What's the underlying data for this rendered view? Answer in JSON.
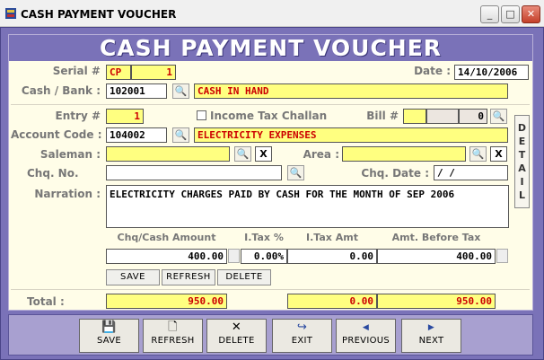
{
  "window": {
    "title": "CASH PAYMENT VOUCHER",
    "minimize_glyph": "_",
    "maximize_glyph": "□",
    "close_glyph": "✕"
  },
  "banner": "CASH PAYMENT VOUCHER",
  "serial": {
    "label": "Serial #",
    "prefix": "CP",
    "number": "1"
  },
  "date": {
    "label": "Date :",
    "value": "14/10/2006"
  },
  "cash_bank": {
    "label": "Cash / Bank :",
    "code": "102001",
    "name": "CASH IN HAND"
  },
  "entry": {
    "label": "Entry #",
    "value": "1"
  },
  "income_tax_challan": {
    "label": "Income Tax Challan",
    "checked": false
  },
  "bill": {
    "label": "Bill #",
    "value": "0"
  },
  "account_code": {
    "label": "Account Code :",
    "code": "104002",
    "name": "ELECTRICITY EXPENSES"
  },
  "saleman": {
    "label": "Saleman :",
    "value": "",
    "clear_glyph": "X"
  },
  "area": {
    "label": "Area :",
    "value": "",
    "clear_glyph": "X"
  },
  "chq_no": {
    "label": "Chq. No.",
    "value": ""
  },
  "chq_date": {
    "label": "Chq. Date :",
    "value": "/  /"
  },
  "narration": {
    "label": "Narration :",
    "value": "ELECTRICITY CHARGES PAID BY CASH FOR THE MONTH OF SEP 2006"
  },
  "detail_tab": {
    "label": "D\nE\nT\nA\nI\nL"
  },
  "amounts": {
    "headers": [
      "Chq/Cash Amount",
      "I.Tax %",
      "I.Tax Amt",
      "Amt. Before Tax"
    ],
    "cash_amount": "400.00",
    "itax_pct": "0.00%",
    "itax_amt": "0.00",
    "amt_before_tax": "400.00"
  },
  "row_buttons": {
    "save": "SAVE",
    "refresh": "REFRESH",
    "delete": "DELETE"
  },
  "totals": {
    "label": "Total :",
    "cash_amount": "950.00",
    "itax_amt": "0.00",
    "amt_before_tax": "950.00"
  },
  "toolbar": {
    "save": "SAVE",
    "refresh": "REFRESH",
    "delete": "DELETE",
    "exit": "EXIT",
    "previous": "PREVIOUS",
    "next": "NEXT"
  },
  "colors": {
    "frame": "#7a72b8",
    "panel": "#fffde8",
    "field_yellow": "#ffff80",
    "accent_red": "#cc0000"
  }
}
